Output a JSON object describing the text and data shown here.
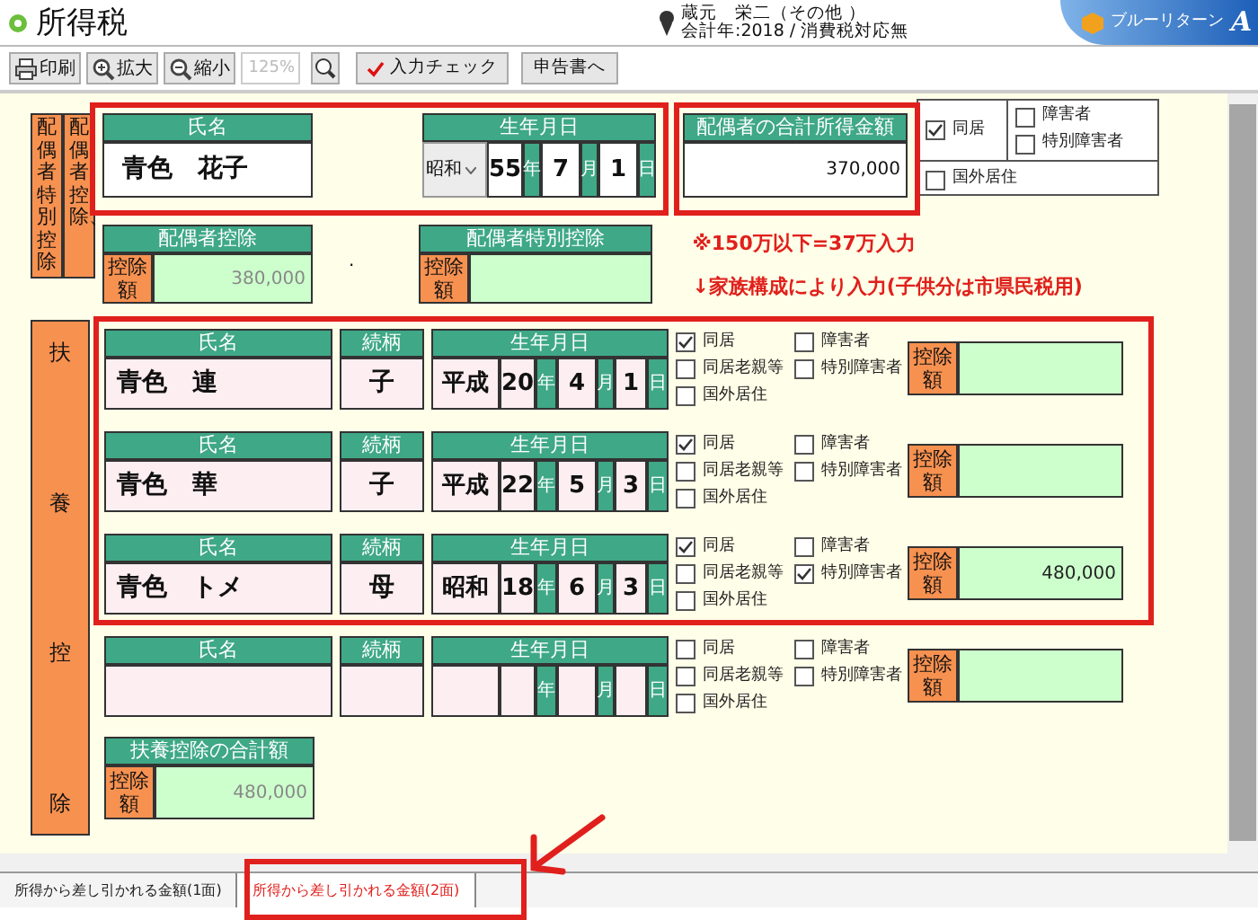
{
  "app": {
    "title": "所得税",
    "user_name": "蔵元　栄二（その他 ）",
    "user_info": "会計年:2018 / 消費税対応無",
    "logo_text": "ブルーリターン",
    "logo_mark": "A"
  },
  "toolbar": {
    "buttons": [
      {
        "label": "印刷",
        "kind": "print"
      },
      {
        "label": "拡大",
        "kind": "zoom-in"
      },
      {
        "label": "縮小",
        "kind": "zoom-out"
      }
    ],
    "zoom_field": {
      "placeholder": "125%"
    },
    "check_button": "入力チェック",
    "return_button": "申告書へ"
  },
  "spouse": {
    "side_labels": [
      "配偶者特別控除",
      "配偶者控除、"
    ],
    "name": {
      "header": "氏名",
      "value": "青色　花子"
    },
    "birth": {
      "header": "生年月日",
      "era": "昭和",
      "year": "55",
      "year_unit": "年",
      "month": "7",
      "month_unit": "月",
      "day": "1",
      "day_unit": "日"
    },
    "income": {
      "header": "配偶者の合計所得金額",
      "value": "370,000"
    },
    "options": [
      {
        "label": "同居",
        "checked": true
      },
      {
        "label": "障害者",
        "checked": false
      },
      {
        "label": "特別障害者",
        "checked": false
      },
      {
        "label": "国外居住",
        "checked": false
      }
    ],
    "deduction": {
      "header": "配偶者控除",
      "label": "控除額",
      "value": "380,000"
    },
    "dot": ".",
    "special_deduction": {
      "header": "配偶者特別控除",
      "label": "控除額"
    }
  },
  "notes": [
    "※150万以下=37万入力",
    "↓家族構成により入力(子供分は市県民税用)"
  ],
  "dependents": {
    "side_label": [
      "扶",
      "養",
      "控",
      "除"
    ],
    "rows": [
      {
        "name_header": "氏名",
        "name": "青色　連",
        "relation_header": "続柄",
        "relation": "子",
        "birth_header": "生年月日",
        "era": "平成",
        "year": "20",
        "year_unit": "年",
        "month": "4",
        "month_unit": "月",
        "day": "1",
        "day_unit": "日",
        "options": [
          {
            "label": "同居",
            "checked": true
          },
          {
            "label": "障害者",
            "checked": false
          },
          {
            "label": "同居老親等",
            "checked": false
          },
          {
            "label": "特別障害者",
            "checked": false
          },
          {
            "label": "国外居住",
            "checked": false
          }
        ],
        "deduction_label": "控除額"
      },
      {
        "name_header": "氏名",
        "name": "青色　華",
        "relation_header": "続柄",
        "relation": "子",
        "birth_header": "生年月日",
        "era": "平成",
        "year": "22",
        "year_unit": "年",
        "month": "5",
        "month_unit": "月",
        "day": "3",
        "day_unit": "日",
        "options": [
          {
            "label": "同居",
            "checked": true
          },
          {
            "label": "障害者",
            "checked": false
          },
          {
            "label": "同居老親等",
            "checked": false
          },
          {
            "label": "特別障害者",
            "checked": false
          },
          {
            "label": "国外居住",
            "checked": false
          }
        ],
        "deduction_label": "控除額"
      },
      {
        "name_header": "氏名",
        "name": "青色　トメ",
        "relation_header": "続柄",
        "relation": "母",
        "birth_header": "生年月日",
        "era": "昭和",
        "year": "18",
        "year_unit": "年",
        "month": "6",
        "month_unit": "月",
        "day": "3",
        "day_unit": "日",
        "options": [
          {
            "label": "同居",
            "checked": true
          },
          {
            "label": "障害者",
            "checked": false
          },
          {
            "label": "同居老親等",
            "checked": false
          },
          {
            "label": "特別障害者",
            "checked": true
          },
          {
            "label": "国外居住",
            "checked": false
          }
        ],
        "deduction_label": "控除額",
        "deduction": "480,000"
      },
      {
        "name_header": "氏名",
        "relation_header": "続柄",
        "birth_header": "生年月日",
        "year_unit": "年",
        "month_unit": "月",
        "day_unit": "日",
        "options": [
          {
            "label": "同居",
            "checked": false
          },
          {
            "label": "障害者",
            "checked": false
          },
          {
            "label": "同居老親等",
            "checked": false
          },
          {
            "label": "特別障害者",
            "checked": false
          },
          {
            "label": "国外居住",
            "checked": false
          }
        ],
        "deduction_label": "控除額"
      }
    ]
  },
  "total": {
    "header": "扶養控除の合計額",
    "label": "控除額",
    "value": "480,000"
  },
  "tabs": [
    {
      "label": "所得から差し引かれる金額(1面)",
      "selected": false
    },
    {
      "label": "所得から差し引かれる金額(2面)",
      "selected": true
    }
  ]
}
